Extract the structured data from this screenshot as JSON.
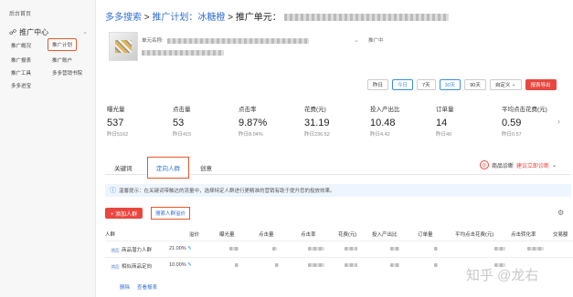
{
  "sidebar": {
    "home": "后台首页",
    "section_title": "推广中心",
    "items": [
      {
        "label": "推广概况"
      },
      {
        "label": "推广计划",
        "active": true
      },
      {
        "label": "推广报表"
      },
      {
        "label": "推广账户"
      },
      {
        "label": "推广工具"
      },
      {
        "label": "多多营销书院"
      },
      {
        "label": "多多进宝"
      }
    ]
  },
  "breadcrumb": {
    "part1": "多多搜索",
    "part2": "推广计划：冰糖橙",
    "part3": "推广单元："
  },
  "product": {
    "name_label": "单元名称:",
    "status": "推广中"
  },
  "date_filter": {
    "buttons": [
      "昨日",
      "今日",
      "7天",
      "30天",
      "90天",
      "自定义",
      "报表导出"
    ],
    "selected": [
      "今日",
      "30天"
    ],
    "accent": "#3a8ee6",
    "export_color": "#e9463f"
  },
  "metrics": [
    {
      "label": "曝光量",
      "value": "537",
      "prev": "昨日5162"
    },
    {
      "label": "点击量",
      "value": "53",
      "prev": "昨日415"
    },
    {
      "label": "点击率",
      "value": "9.87%",
      "prev": "昨日8.04%"
    },
    {
      "label": "花费(元)",
      "value": "31.19",
      "prev": "昨日236.52"
    },
    {
      "label": "投入产出比",
      "value": "10.48",
      "prev": "昨日4.42"
    },
    {
      "label": "订单量",
      "value": "14",
      "prev": "昨日40"
    },
    {
      "label": "平均点击花费(元)",
      "value": "0.59",
      "prev": "昨日0.57"
    }
  ],
  "tabs": [
    {
      "label": "关键词"
    },
    {
      "label": "定向人群",
      "active": true
    },
    {
      "label": "创意"
    }
  ],
  "diagnosis": {
    "label": "商品诊断",
    "link": "建议立即诊断"
  },
  "info_text": "温馨提示：在关键词带触达的流量中，选择特定人群进行更精准的营销有助于提升您的投放效果。",
  "toolbar": {
    "add_label": "+ 添加人群",
    "search_label": "搜索人群溢价"
  },
  "table": {
    "headers": [
      "人群",
      "溢价",
      "曝光量",
      "点击量",
      "点击率",
      "花费(元)",
      "投入产出比",
      "订单量",
      "平均点击花费(元)",
      "点击转化率",
      "交易额"
    ],
    "rows": [
      {
        "tag": "商品",
        "name": "商品潜力人群",
        "premium": "21.00%"
      },
      {
        "tag": "商品",
        "name": "相似商品定向",
        "premium": "10.00%"
      }
    ],
    "ops": [
      "删除",
      "查看报表"
    ]
  },
  "watermark": "知乎 @龙右"
}
